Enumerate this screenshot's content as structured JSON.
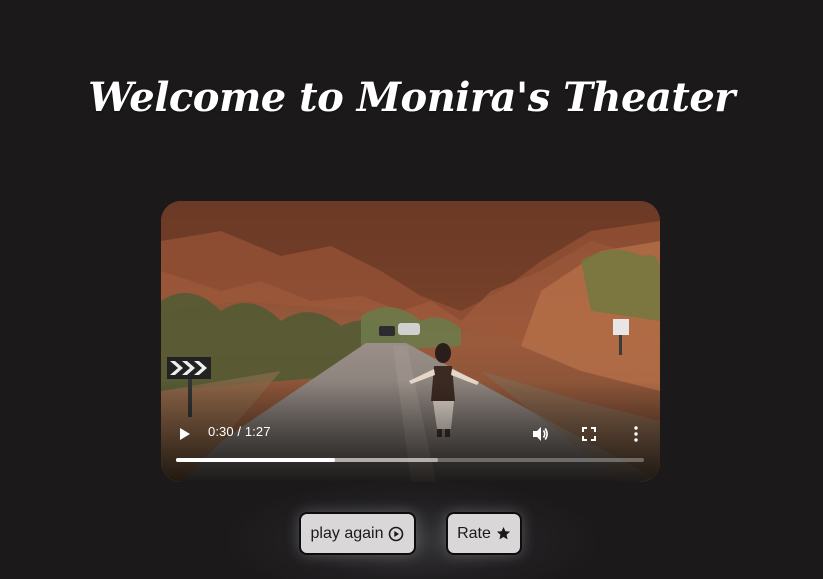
{
  "header": {
    "title": "Welcome to Monira's Theater"
  },
  "video": {
    "current_time": "0:30",
    "duration": "1:27",
    "time_display": "0:30 / 1:27",
    "progress": 0.34,
    "buffered": 0.56,
    "icons": {
      "play": "play-icon",
      "volume": "volume-icon",
      "fullscreen": "fullscreen-icon",
      "more": "more-options-icon"
    }
  },
  "buttons": {
    "play_again_label": "play again",
    "play_again_icon": "play-circle-icon",
    "rate_label": "Rate",
    "rate_icon": "star-icon"
  },
  "colors": {
    "background": "#1b191a",
    "button_bg": "#dad7d8",
    "text_light": "#ffffff"
  }
}
